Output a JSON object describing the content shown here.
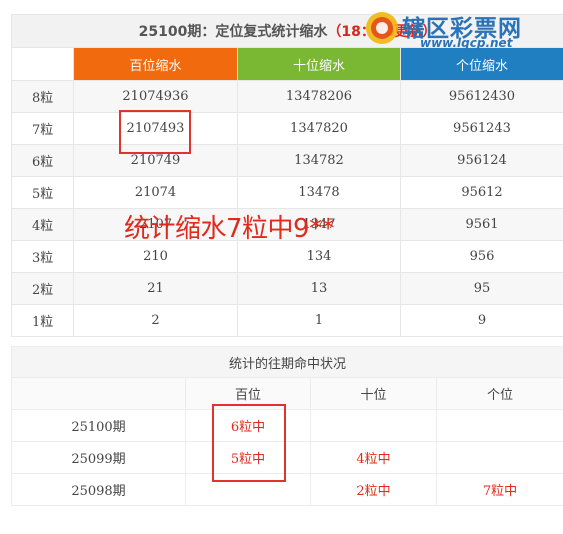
{
  "top_table": {
    "title_main": "25100期：定位复式统计缩水",
    "title_time": "（18：00更新）",
    "headers": [
      "百位缩水",
      "十位缩水",
      "个位缩水"
    ],
    "rows": [
      {
        "label": "8粒",
        "hundreds": "21074936",
        "tens": "13478206",
        "units": "95612430"
      },
      {
        "label": "7粒",
        "hundreds": "2107493",
        "tens": "1347820",
        "units": "9561243"
      },
      {
        "label": "6粒",
        "hundreds": "210749",
        "tens": "134782",
        "units": "956124"
      },
      {
        "label": "5粒",
        "hundreds": "21074",
        "tens": "13478",
        "units": "95612"
      },
      {
        "label": "4粒",
        "hundreds": "2107",
        "tens": "1347",
        "units": "9561"
      },
      {
        "label": "3粒",
        "hundreds": "210",
        "tens": "134",
        "units": "956"
      },
      {
        "label": "2粒",
        "hundreds": "21",
        "tens": "13",
        "units": "95"
      },
      {
        "label": "1粒",
        "hundreds": "2",
        "tens": "1",
        "units": "9"
      }
    ]
  },
  "bottom_table": {
    "title": "统计的往期命中状况",
    "headers": [
      "百位",
      "十位",
      "个位"
    ],
    "rows": [
      {
        "issue": "25100期",
        "hundreds": "6粒中",
        "tens": "",
        "units": ""
      },
      {
        "issue": "25099期",
        "hundreds": "5粒中",
        "tens": "4粒中",
        "units": ""
      },
      {
        "issue": "25098期",
        "hundreds": "",
        "tens": "2粒中",
        "units": "7粒中"
      }
    ]
  },
  "overlay": {
    "annotation": "统计缩水7粒中9**"
  },
  "watermark": {
    "name": "辖区彩票网",
    "url": "www.lqcp.net"
  },
  "colors": {
    "hundreds_header": "#f26a0e",
    "tens_header": "#7ab833",
    "units_header": "#1f7fc1",
    "highlight_red": "#e02a1d"
  }
}
